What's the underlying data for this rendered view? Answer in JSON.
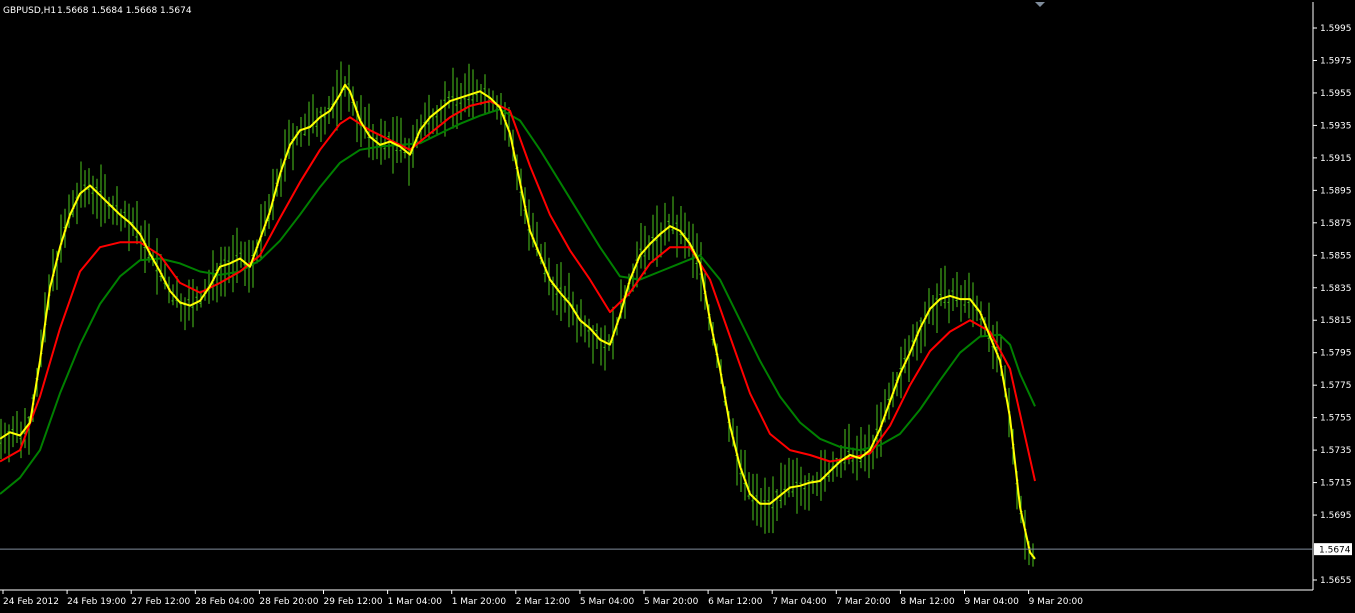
{
  "header": {
    "symbol": "GBPUSD,H1",
    "ohlc": "1.5668 1.5684 1.5668 1.5674"
  },
  "colors": {
    "background": "#000000",
    "axis": "#ffffff",
    "bars": "#4cc61b",
    "ma_fast": "#ffff00",
    "ma_mid": "#ff0000",
    "ma_slow": "#008000",
    "current_price_line": "#7f8c9b"
  },
  "chart_data": {
    "type": "line",
    "title": "GBPUSD,H1",
    "ohlc_readout": "1.5668 1.5684 1.5668 1.5674",
    "current_price": 1.5674,
    "current_price_label": "1.5674",
    "ylim": [
      1.5655,
      1.5995
    ],
    "grid": false,
    "y_ticks": [
      "1.5995",
      "1.5975",
      "1.5955",
      "1.5935",
      "1.5915",
      "1.5895",
      "1.5875",
      "1.5855",
      "1.5835",
      "1.5815",
      "1.5795",
      "1.5775",
      "1.5755",
      "1.5735",
      "1.5715",
      "1.5695",
      "1.5655"
    ],
    "x_labels": [
      "24 Feb 2012",
      "24 Feb 19:00",
      "27 Feb 12:00",
      "28 Feb 04:00",
      "28 Feb 20:00",
      "29 Feb 12:00",
      "1 Mar 04:00",
      "1 Mar 20:00",
      "2 Mar 12:00",
      "5 Mar 04:00",
      "5 Mar 20:00",
      "6 Mar 12:00",
      "7 Mar 04:00",
      "7 Mar 20:00",
      "8 Mar 12:00",
      "9 Mar 04:00",
      "9 Mar 20:00"
    ],
    "series": [
      {
        "key": "fast",
        "points": [
          [
            0,
            1.5742
          ],
          [
            10,
            1.5746
          ],
          [
            20,
            1.5744
          ],
          [
            30,
            1.5752
          ],
          [
            40,
            1.579
          ],
          [
            50,
            1.5835
          ],
          [
            60,
            1.586
          ],
          [
            70,
            1.588
          ],
          [
            80,
            1.5893
          ],
          [
            90,
            1.5898
          ],
          [
            100,
            1.5892
          ],
          [
            110,
            1.5886
          ],
          [
            120,
            1.588
          ],
          [
            130,
            1.5875
          ],
          [
            140,
            1.5868
          ],
          [
            150,
            1.5856
          ],
          [
            160,
            1.5845
          ],
          [
            170,
            1.5833
          ],
          [
            180,
            1.5826
          ],
          [
            190,
            1.5824
          ],
          [
            200,
            1.5827
          ],
          [
            210,
            1.5836
          ],
          [
            220,
            1.5848
          ],
          [
            230,
            1.585
          ],
          [
            240,
            1.5853
          ],
          [
            250,
            1.5848
          ],
          [
            260,
            1.5865
          ],
          [
            270,
            1.5882
          ],
          [
            280,
            1.5905
          ],
          [
            290,
            1.5923
          ],
          [
            300,
            1.5932
          ],
          [
            310,
            1.5934
          ],
          [
            320,
            1.594
          ],
          [
            330,
            1.5944
          ],
          [
            340,
            1.5954
          ],
          [
            345,
            1.596
          ],
          [
            350,
            1.5956
          ],
          [
            360,
            1.5938
          ],
          [
            370,
            1.5928
          ],
          [
            380,
            1.5923
          ],
          [
            390,
            1.5925
          ],
          [
            400,
            1.5922
          ],
          [
            410,
            1.5917
          ],
          [
            420,
            1.5932
          ],
          [
            430,
            1.594
          ],
          [
            440,
            1.5945
          ],
          [
            450,
            1.595
          ],
          [
            460,
            1.5952
          ],
          [
            470,
            1.5954
          ],
          [
            480,
            1.5956
          ],
          [
            490,
            1.5952
          ],
          [
            500,
            1.5946
          ],
          [
            510,
            1.593
          ],
          [
            520,
            1.59
          ],
          [
            530,
            1.587
          ],
          [
            540,
            1.5855
          ],
          [
            550,
            1.584
          ],
          [
            560,
            1.5832
          ],
          [
            570,
            1.5825
          ],
          [
            580,
            1.5815
          ],
          [
            590,
            1.581
          ],
          [
            600,
            1.5803
          ],
          [
            610,
            1.58
          ],
          [
            620,
            1.5818
          ],
          [
            630,
            1.584
          ],
          [
            640,
            1.5855
          ],
          [
            650,
            1.5862
          ],
          [
            660,
            1.5868
          ],
          [
            670,
            1.5873
          ],
          [
            680,
            1.587
          ],
          [
            690,
            1.5862
          ],
          [
            700,
            1.585
          ],
          [
            710,
            1.5815
          ],
          [
            720,
            1.5785
          ],
          [
            730,
            1.575
          ],
          [
            740,
            1.5725
          ],
          [
            750,
            1.5708
          ],
          [
            760,
            1.5702
          ],
          [
            770,
            1.5702
          ],
          [
            780,
            1.5707
          ],
          [
            790,
            1.5712
          ],
          [
            800,
            1.5713
          ],
          [
            810,
            1.5715
          ],
          [
            820,
            1.5716
          ],
          [
            830,
            1.5722
          ],
          [
            840,
            1.5728
          ],
          [
            850,
            1.5732
          ],
          [
            860,
            1.573
          ],
          [
            870,
            1.5735
          ],
          [
            880,
            1.5748
          ],
          [
            890,
            1.5765
          ],
          [
            900,
            1.5782
          ],
          [
            910,
            1.5795
          ],
          [
            920,
            1.581
          ],
          [
            930,
            1.5822
          ],
          [
            940,
            1.5828
          ],
          [
            950,
            1.583
          ],
          [
            960,
            1.5828
          ],
          [
            970,
            1.5828
          ],
          [
            980,
            1.582
          ],
          [
            990,
            1.5805
          ],
          [
            1000,
            1.579
          ],
          [
            1010,
            1.5755
          ],
          [
            1020,
            1.57
          ],
          [
            1030,
            1.5672
          ],
          [
            1035,
            1.5668
          ]
        ]
      },
      {
        "key": "mid",
        "points": [
          [
            0,
            1.5728
          ],
          [
            20,
            1.5735
          ],
          [
            40,
            1.5768
          ],
          [
            60,
            1.581
          ],
          [
            80,
            1.5845
          ],
          [
            100,
            1.586
          ],
          [
            120,
            1.5863
          ],
          [
            140,
            1.5863
          ],
          [
            160,
            1.5855
          ],
          [
            180,
            1.5838
          ],
          [
            200,
            1.5832
          ],
          [
            220,
            1.5838
          ],
          [
            240,
            1.5845
          ],
          [
            260,
            1.5855
          ],
          [
            280,
            1.5878
          ],
          [
            300,
            1.59
          ],
          [
            320,
            1.592
          ],
          [
            340,
            1.5936
          ],
          [
            350,
            1.594
          ],
          [
            370,
            1.5932
          ],
          [
            390,
            1.5926
          ],
          [
            410,
            1.592
          ],
          [
            430,
            1.593
          ],
          [
            450,
            1.594
          ],
          [
            470,
            1.5947
          ],
          [
            490,
            1.595
          ],
          [
            510,
            1.5944
          ],
          [
            530,
            1.591
          ],
          [
            550,
            1.588
          ],
          [
            570,
            1.5858
          ],
          [
            590,
            1.584
          ],
          [
            610,
            1.582
          ],
          [
            630,
            1.5832
          ],
          [
            650,
            1.585
          ],
          [
            670,
            1.586
          ],
          [
            690,
            1.586
          ],
          [
            710,
            1.584
          ],
          [
            730,
            1.5805
          ],
          [
            750,
            1.577
          ],
          [
            770,
            1.5745
          ],
          [
            790,
            1.5735
          ],
          [
            810,
            1.5732
          ],
          [
            830,
            1.5728
          ],
          [
            850,
            1.573
          ],
          [
            870,
            1.5733
          ],
          [
            890,
            1.575
          ],
          [
            910,
            1.5775
          ],
          [
            930,
            1.5796
          ],
          [
            950,
            1.5808
          ],
          [
            970,
            1.5815
          ],
          [
            990,
            1.5808
          ],
          [
            1010,
            1.5785
          ],
          [
            1035,
            1.5716
          ]
        ]
      },
      {
        "key": "slow",
        "points": [
          [
            0,
            1.5708
          ],
          [
            20,
            1.5718
          ],
          [
            40,
            1.5735
          ],
          [
            60,
            1.577
          ],
          [
            80,
            1.58
          ],
          [
            100,
            1.5825
          ],
          [
            120,
            1.5842
          ],
          [
            140,
            1.5852
          ],
          [
            160,
            1.5853
          ],
          [
            180,
            1.585
          ],
          [
            200,
            1.5845
          ],
          [
            220,
            1.5843
          ],
          [
            240,
            1.5845
          ],
          [
            260,
            1.5852
          ],
          [
            280,
            1.5864
          ],
          [
            300,
            1.588
          ],
          [
            320,
            1.5897
          ],
          [
            340,
            1.5912
          ],
          [
            360,
            1.592
          ],
          [
            380,
            1.5922
          ],
          [
            400,
            1.5923
          ],
          [
            420,
            1.5924
          ],
          [
            440,
            1.593
          ],
          [
            460,
            1.5936
          ],
          [
            480,
            1.5941
          ],
          [
            500,
            1.5945
          ],
          [
            520,
            1.5938
          ],
          [
            540,
            1.592
          ],
          [
            560,
            1.59
          ],
          [
            580,
            1.588
          ],
          [
            600,
            1.586
          ],
          [
            620,
            1.5842
          ],
          [
            640,
            1.584
          ],
          [
            660,
            1.5845
          ],
          [
            680,
            1.585
          ],
          [
            700,
            1.5855
          ],
          [
            720,
            1.584
          ],
          [
            740,
            1.5815
          ],
          [
            760,
            1.579
          ],
          [
            780,
            1.5768
          ],
          [
            800,
            1.5752
          ],
          [
            820,
            1.5742
          ],
          [
            840,
            1.5737
          ],
          [
            860,
            1.5735
          ],
          [
            880,
            1.5738
          ],
          [
            900,
            1.5745
          ],
          [
            920,
            1.576
          ],
          [
            940,
            1.5778
          ],
          [
            960,
            1.5795
          ],
          [
            980,
            1.5805
          ],
          [
            1000,
            1.5806
          ],
          [
            1010,
            1.58
          ],
          [
            1020,
            1.5782
          ],
          [
            1035,
            1.5762
          ]
        ]
      }
    ]
  }
}
